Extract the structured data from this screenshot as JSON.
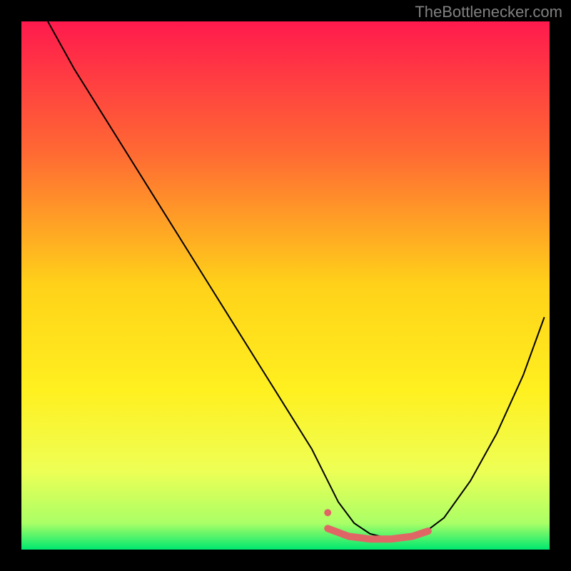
{
  "watermark": "TheBottlenecker.com",
  "chart_data": {
    "type": "line",
    "title": "",
    "xlabel": "",
    "ylabel": "",
    "xlim": [
      0,
      100
    ],
    "ylim": [
      0,
      100
    ],
    "background_gradient": {
      "stops": [
        {
          "offset": 0,
          "color": "#ff1a4d"
        },
        {
          "offset": 25,
          "color": "#ff6a33"
        },
        {
          "offset": 50,
          "color": "#ffd219"
        },
        {
          "offset": 70,
          "color": "#fff020"
        },
        {
          "offset": 85,
          "color": "#eeff55"
        },
        {
          "offset": 95,
          "color": "#aaff66"
        },
        {
          "offset": 100,
          "color": "#00e870"
        }
      ]
    },
    "series": [
      {
        "name": "curve",
        "stroke": "#000000",
        "stroke_width": 2,
        "x": [
          5,
          10,
          15,
          20,
          25,
          30,
          35,
          40,
          45,
          50,
          55,
          58,
          60,
          63,
          66,
          70,
          73,
          76,
          80,
          85,
          90,
          95,
          99
        ],
        "y": [
          100,
          91,
          83,
          75,
          67,
          59,
          51,
          43,
          35,
          27,
          19,
          13,
          9,
          5,
          3,
          2,
          2,
          3,
          6,
          13,
          22,
          33,
          44
        ]
      },
      {
        "name": "highlight",
        "stroke": "#e06666",
        "stroke_width": 10,
        "linecap": "round",
        "dot_start": {
          "x": 58,
          "y": 7,
          "r": 5
        },
        "x": [
          58,
          62,
          66,
          70,
          74,
          77
        ],
        "y": [
          4,
          2.5,
          2,
          2,
          2.5,
          3.5
        ]
      }
    ]
  }
}
